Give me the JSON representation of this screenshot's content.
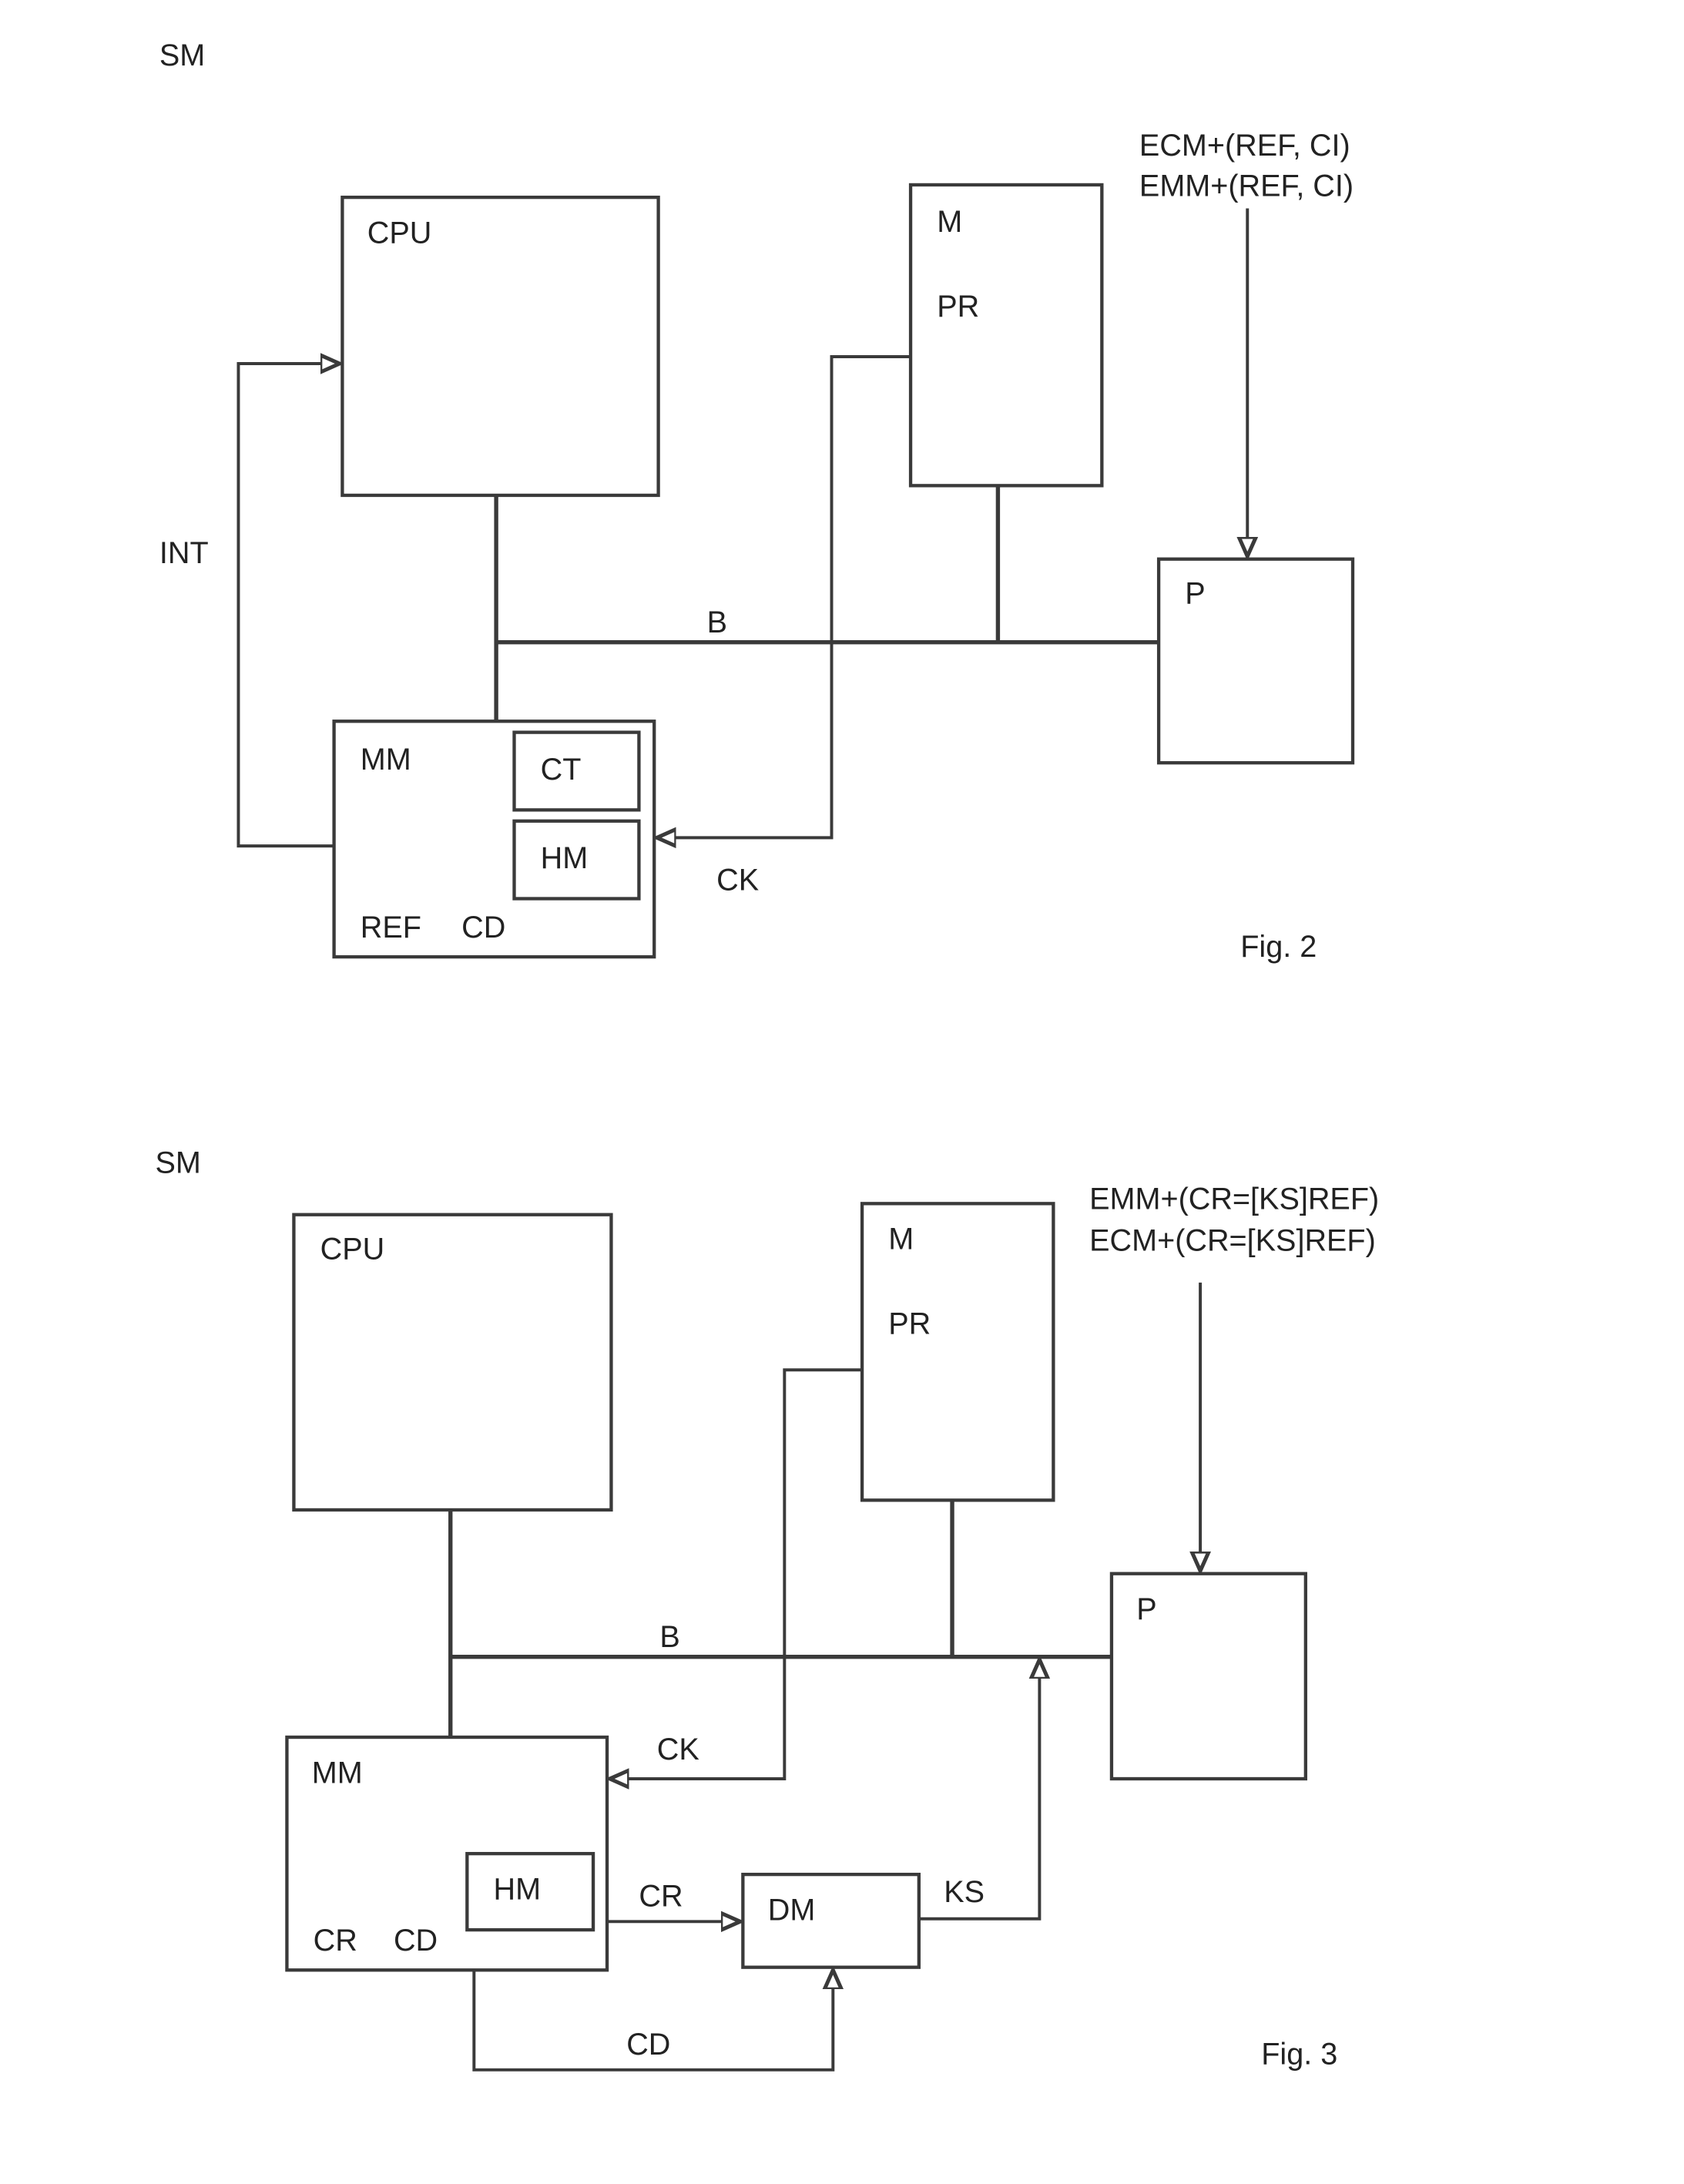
{
  "figures": {
    "fig2": {
      "caption": "Fig. 2",
      "system_label": "SM",
      "cpu": {
        "label": "CPU"
      },
      "memory": {
        "label": "M",
        "program_label": "PR"
      },
      "processor": {
        "label": "P"
      },
      "bus_label": "B",
      "mm": {
        "label": "MM",
        "ct_label": "CT",
        "hm_label": "HM",
        "ref_label": "REF",
        "cd_label": "CD"
      },
      "interrupt_label": "INT",
      "clock_label": "CK",
      "input_messages": [
        "ECM+(REF, CI)",
        "EMM+(REF, CI)"
      ]
    },
    "fig3": {
      "caption": "Fig. 3",
      "system_label": "SM",
      "cpu": {
        "label": "CPU"
      },
      "memory": {
        "label": "M",
        "program_label": "PR"
      },
      "processor": {
        "label": "P"
      },
      "bus_label": "B",
      "mm": {
        "label": "MM",
        "hm_label": "HM",
        "cr_label": "CR",
        "cd_label": "CD"
      },
      "dm": {
        "label": "DM"
      },
      "clock_label": "CK",
      "cr_arrow_label": "CR",
      "ks_label": "KS",
      "cd_arrow_label": "CD",
      "input_messages": [
        "EMM+(CR=[KS]REF)",
        "ECM+(CR=[KS]REF)"
      ]
    }
  }
}
